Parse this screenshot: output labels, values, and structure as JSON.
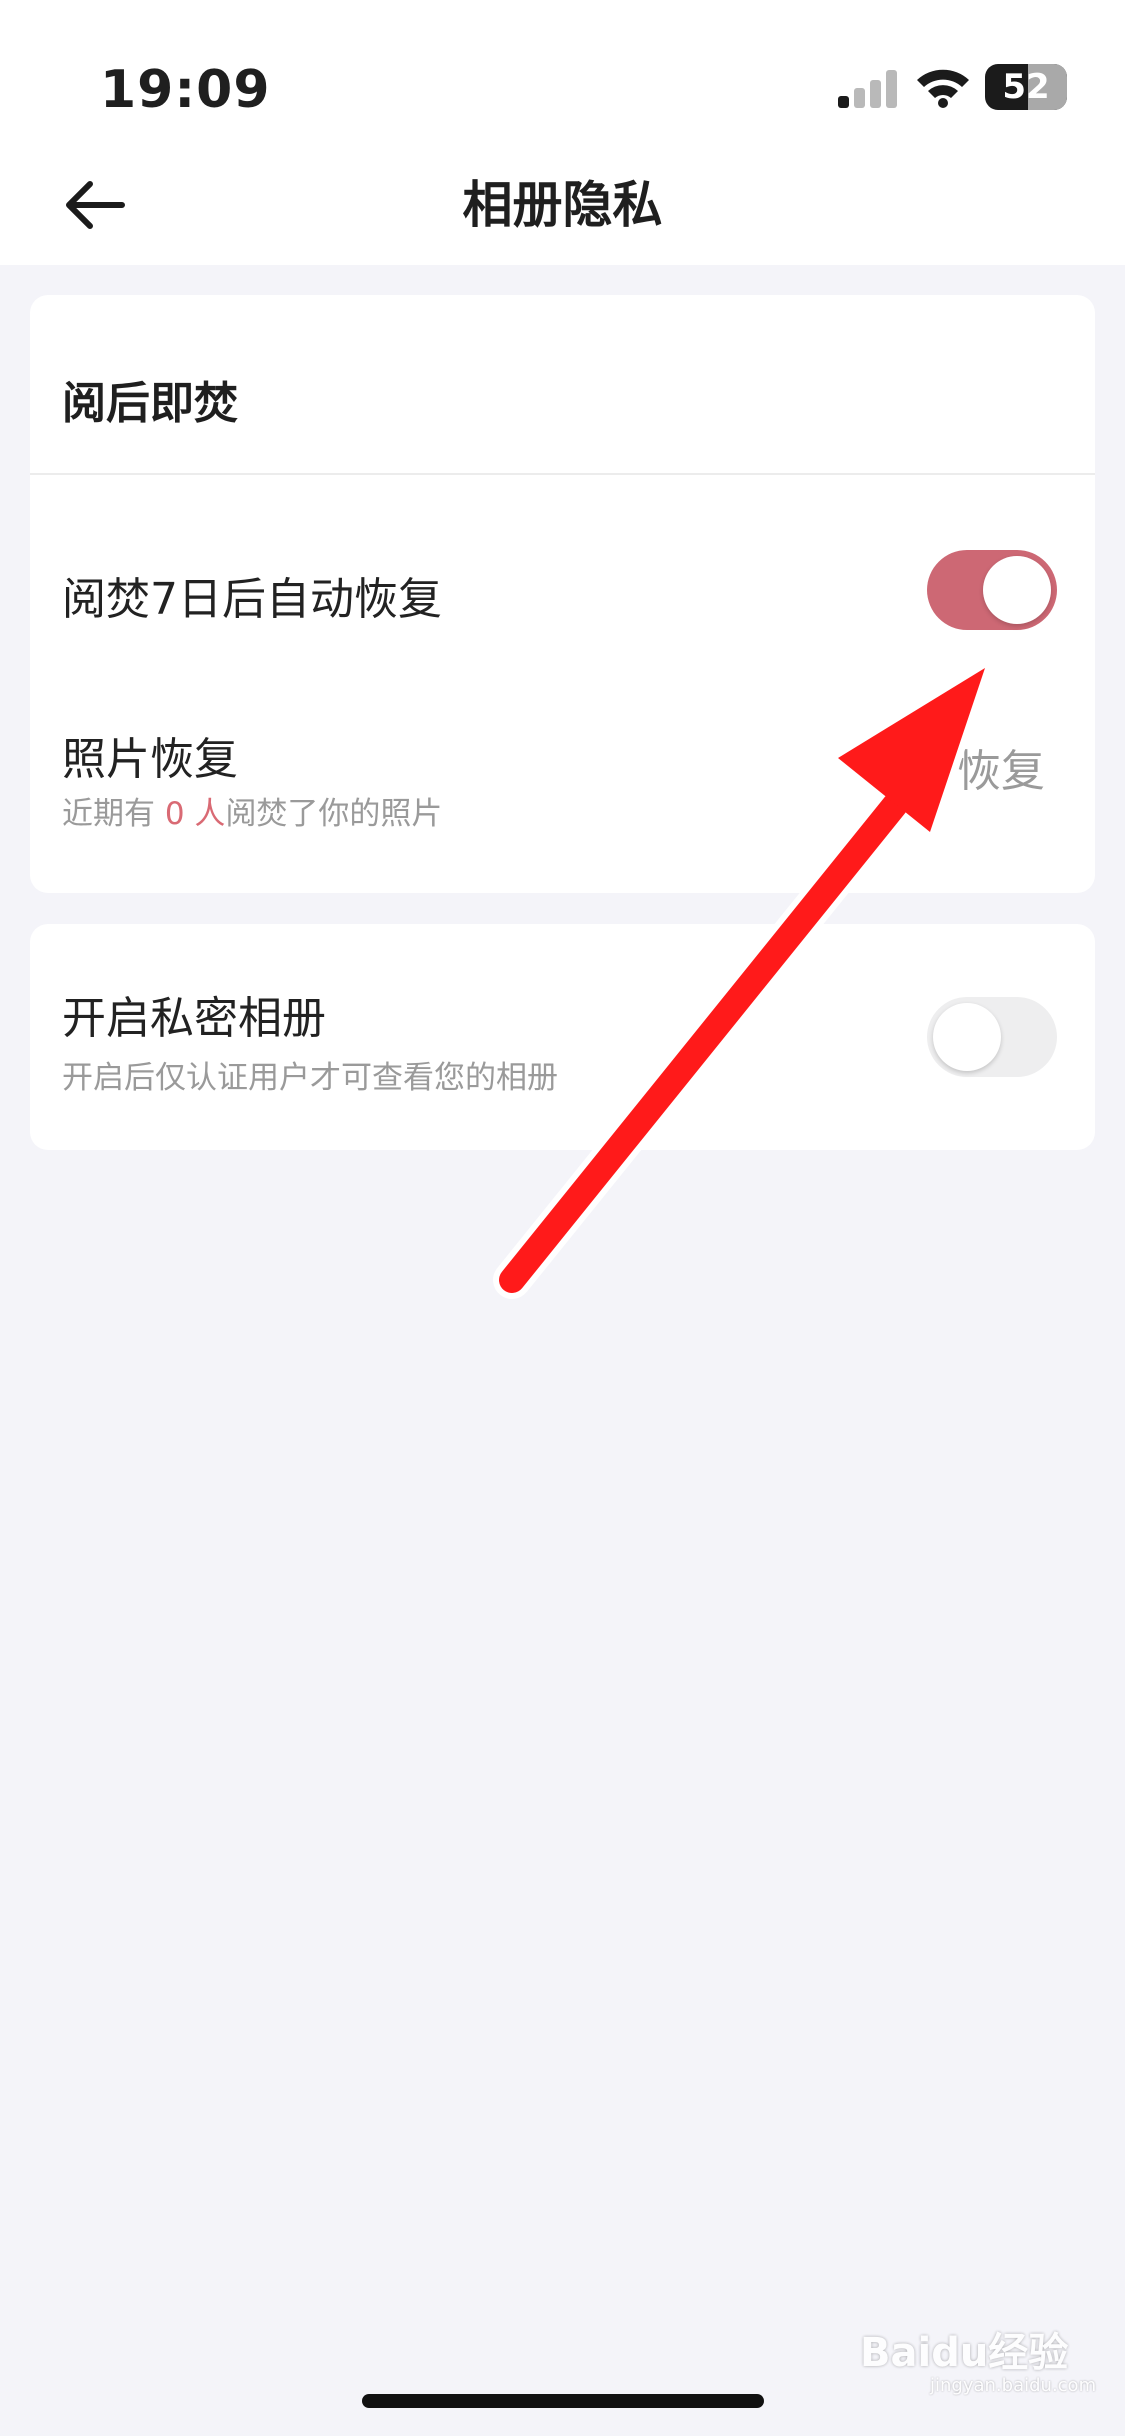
{
  "status_bar": {
    "time": "19:09",
    "battery": "52",
    "battery_level": 0.52
  },
  "nav": {
    "title": "相册隐私"
  },
  "card_burn": {
    "section_title": "阅后即焚",
    "auto_restore": {
      "label": "阅焚7日后自动恢复",
      "enabled": true
    },
    "photo_restore": {
      "label": "照片恢复",
      "sub_prefix": "近期有 ",
      "count": "0 人",
      "sub_suffix": "阅焚了你的照片",
      "action": "恢复"
    }
  },
  "card_private": {
    "label": "开启私密相册",
    "sub": "开启后仅认证用户才可查看您的相册",
    "enabled": false
  },
  "colors": {
    "accent": "#cd6874",
    "arrow": "#ff1a1a",
    "background": "#f4f4f9"
  },
  "watermark": {
    "brand": "Baidu经验",
    "site": "jingyan.baidu.com"
  }
}
